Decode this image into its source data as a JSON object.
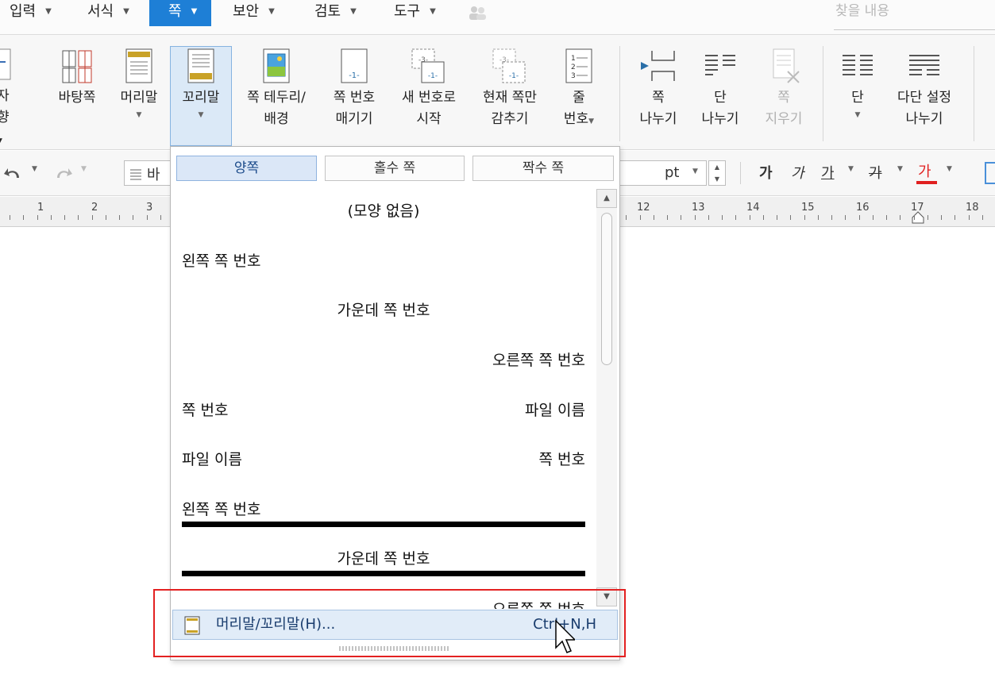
{
  "menubar": {
    "items": [
      {
        "label": "입력"
      },
      {
        "label": "서식"
      },
      {
        "label": "쪽"
      },
      {
        "label": "보안"
      },
      {
        "label": "검토"
      },
      {
        "label": "도구"
      }
    ],
    "search_placeholder": "찾을 내용"
  },
  "ribbon": {
    "partial_left": {
      "line1": "자",
      "line2": "향"
    },
    "bataang": "바탕쪽",
    "header": "머리말",
    "footer": "꼬리말",
    "border": {
      "line1": "쪽 테두리/",
      "line2": "배경"
    },
    "pagenum": {
      "line1": "쪽 번호",
      "line2": "매기기"
    },
    "newnum": {
      "line1": "새 번호로",
      "line2": "시작"
    },
    "hide": {
      "line1": "현재 쪽만",
      "line2": "감추기"
    },
    "linenum": {
      "line1": "줄",
      "line2": "번호"
    },
    "pagebreak": {
      "line1": "쪽",
      "line2": "나누기"
    },
    "colbreak": {
      "line1": "단",
      "line2": "나누기"
    },
    "delpage": {
      "line1": "쪽",
      "line2": "지우기"
    },
    "columns": "단",
    "multicol": {
      "line1": "다단 설정",
      "line2": "나누기"
    },
    "icon_pagenum": "-1-",
    "icon_new_top": "-3-",
    "icon_new_bot": "-1-",
    "icon_line1": "1",
    "icon_line2": "2",
    "icon_line3": "3"
  },
  "toolbar": {
    "style_value": "바",
    "unit": "pt",
    "bold": "가",
    "italic": "가",
    "underline": "가",
    "strike": "가",
    "color": "가",
    "colors": {
      "font_color": "#e02020"
    }
  },
  "ruler": {
    "numbers": [
      "1",
      "2",
      "3",
      "12",
      "13",
      "14",
      "15",
      "16",
      "17",
      "18"
    ]
  },
  "dropdown": {
    "tabs": [
      {
        "label": "양쪽",
        "selected": true
      },
      {
        "label": "홀수 쪽",
        "selected": false
      },
      {
        "label": "짝수 쪽",
        "selected": false
      }
    ],
    "options": {
      "none": "(모양 없음)",
      "left_pagenum": "왼쪽 쪽 번호",
      "center_pagenum": "가운데 쪽 번호",
      "right_pagenum": "오른쪽 쪽 번호",
      "pn_file_left": "쪽 번호",
      "pn_file_right": "파일 이름",
      "file_pn_left": "파일 이름",
      "file_pn_right": "쪽 번호",
      "left_line": "왼쪽 쪽 번호",
      "center_line": "가운데 쪽 번호",
      "right_line_partial": "오른쪽 쪽 번호"
    },
    "command": {
      "label": "머리말/꼬리말(H)...",
      "shortcut": "Ctrl+N,H"
    }
  },
  "colors": {
    "accent": "#1e7fd6",
    "highlight": "#e32121",
    "selection": "#dbe7f7"
  }
}
